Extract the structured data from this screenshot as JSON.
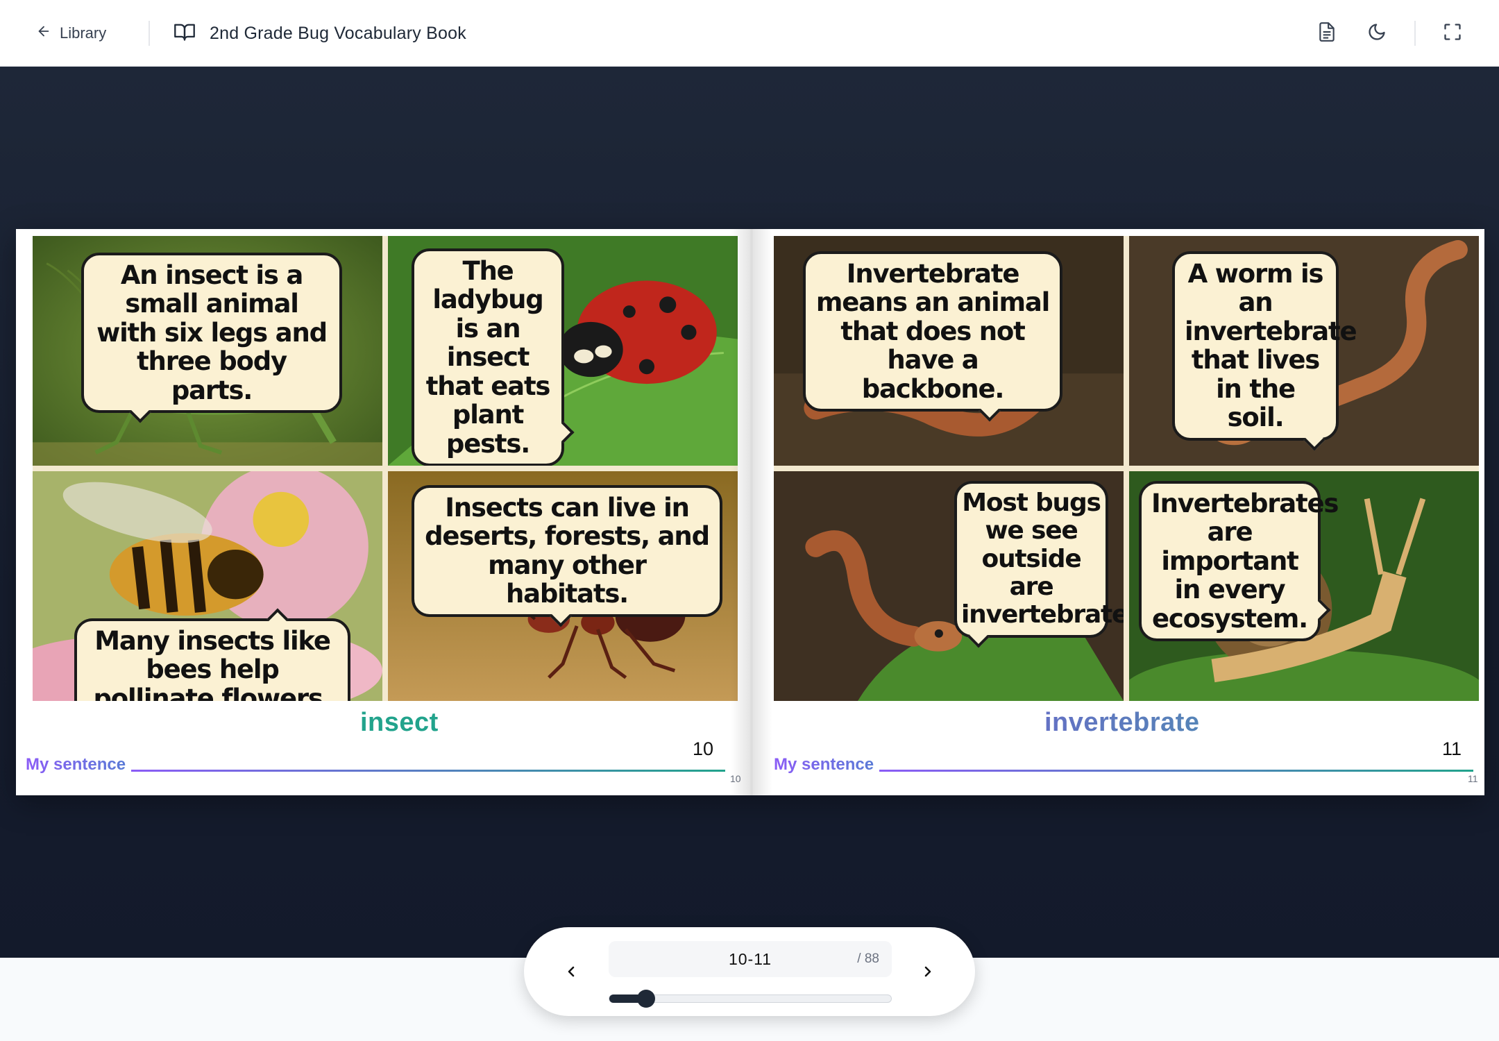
{
  "header": {
    "back_label": "Library",
    "title": "2nd Grade Bug Vocabulary Book",
    "icons": [
      "arrow-left-icon",
      "book-open-icon",
      "document-icon",
      "moon-icon",
      "fullscreen-icon"
    ]
  },
  "spread": {
    "left": {
      "vocab_word": "insect",
      "sentence_label": "My sentence",
      "page_number": "10",
      "corner_number": "10",
      "bubbles": [
        "An insect is a small animal with six legs and three body parts.",
        "The ladybug is an insect that eats plant pests.",
        "Many insects like bees help pollinate flowers.",
        "Insects can live in deserts, forests, and many other habitats."
      ]
    },
    "right": {
      "vocab_word": "invertebrate",
      "sentence_label": "My sentence",
      "page_number": "11",
      "corner_number": "11",
      "bubbles": [
        "Invertebrate means an animal that does not have a backbone.",
        "A worm is an invertebrate that lives in the soil.",
        "Most bugs we see outside are invertebrates.",
        "Invertebrates are important in every ecosystem."
      ]
    }
  },
  "navigation": {
    "current_pages": "10-11",
    "total_pages": "/ 88",
    "progress": 0.13,
    "prev_icon": "chevron-left-icon",
    "next_icon": "chevron-right-icon"
  },
  "colors": {
    "insect_word": "#22a38c",
    "invertebrate_word": "#7c4ddc",
    "sentence_label": "#8b5cf6",
    "reader_background": "#1a2133"
  }
}
